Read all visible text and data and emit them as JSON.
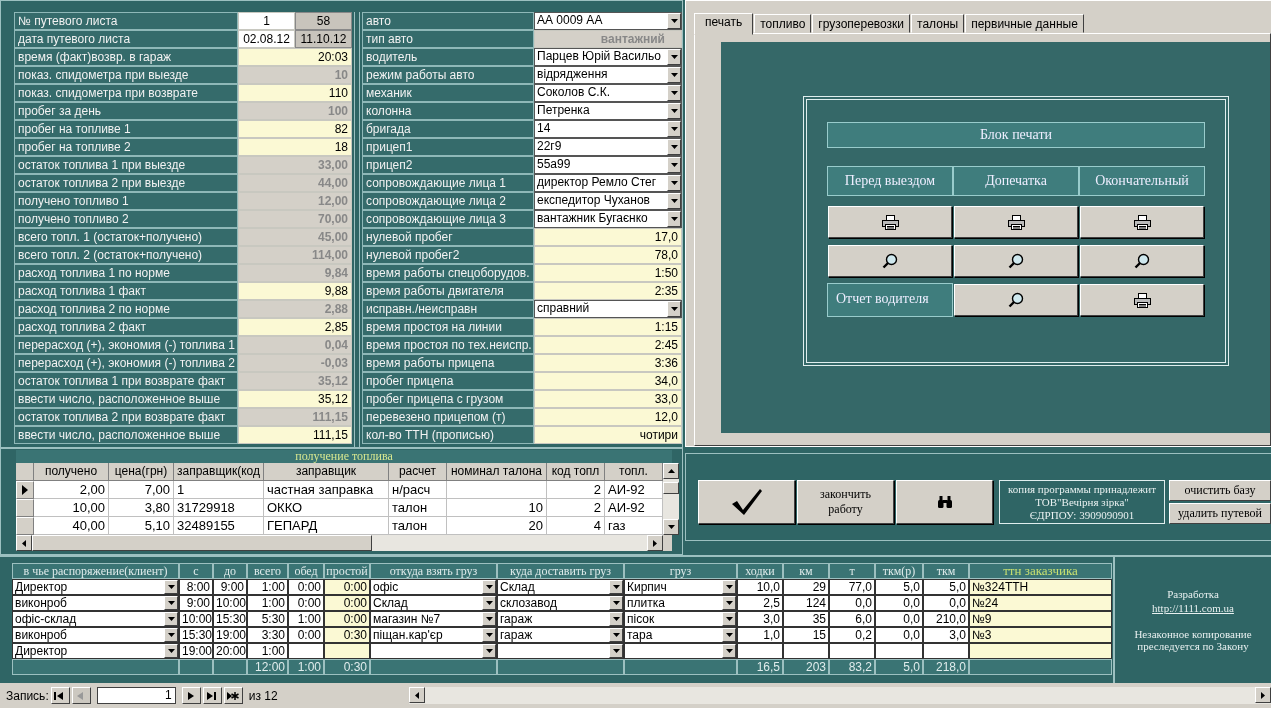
{
  "form": {
    "left": [
      {
        "label": "№ путевого листа",
        "values": [
          {
            "text": "1",
            "kind": "plain"
          },
          {
            "text": "58",
            "kind": "locked"
          }
        ]
      },
      {
        "label": "дата путевого листа",
        "values": [
          {
            "text": "02.08.12",
            "kind": "plain"
          },
          {
            "text": "11.10.12",
            "kind": "locked"
          }
        ]
      },
      {
        "label": "время (факт)возвр. в гараж",
        "values": [
          {
            "text": "20:03",
            "kind": "input"
          }
        ]
      },
      {
        "label": "показ. спидометра при выезде",
        "values": [
          {
            "text": "10",
            "kind": "calc"
          }
        ]
      },
      {
        "label": "показ. спидометра при возврате",
        "values": [
          {
            "text": "110",
            "kind": "input"
          }
        ]
      },
      {
        "label": "пробег за день",
        "values": [
          {
            "text": "100",
            "kind": "calc"
          }
        ]
      },
      {
        "label": "пробег на топливе 1",
        "values": [
          {
            "text": "82",
            "kind": "input"
          }
        ]
      },
      {
        "label": "пробег на топливе 2",
        "values": [
          {
            "text": "18",
            "kind": "input"
          }
        ]
      },
      {
        "label": "остаток  топлива 1 при выезде",
        "values": [
          {
            "text": "33,00",
            "kind": "calc"
          }
        ]
      },
      {
        "label": "остаток топлива 2 при выезде",
        "values": [
          {
            "text": "44,00",
            "kind": "calc"
          }
        ]
      },
      {
        "label": "получено топливо 1",
        "values": [
          {
            "text": "12,00",
            "kind": "calc"
          }
        ]
      },
      {
        "label": "получено топливо 2",
        "values": [
          {
            "text": "70,00",
            "kind": "calc"
          }
        ]
      },
      {
        "label": "всего топл. 1 (остаток+получено)",
        "values": [
          {
            "text": "45,00",
            "kind": "calc"
          }
        ]
      },
      {
        "label": "всего топл. 2 (остаток+получено)",
        "values": [
          {
            "text": "114,00",
            "kind": "calc"
          }
        ]
      },
      {
        "label": "расход топлива 1 по норме",
        "values": [
          {
            "text": "9,84",
            "kind": "calc"
          }
        ]
      },
      {
        "label": "расход топлива 1 факт",
        "values": [
          {
            "text": "9,88",
            "kind": "input"
          }
        ]
      },
      {
        "label": "расход топлива 2 по норме",
        "values": [
          {
            "text": "2,88",
            "kind": "calc"
          }
        ]
      },
      {
        "label": "расход топлива 2 факт",
        "values": [
          {
            "text": "2,85",
            "kind": "input"
          }
        ]
      },
      {
        "label": "перерасход (+), экономия (-) топлива 1",
        "values": [
          {
            "text": "0,04",
            "kind": "calc"
          }
        ]
      },
      {
        "label": "перерасход (+), экономия (-) топлива 2",
        "values": [
          {
            "text": "-0,03",
            "kind": "calc"
          }
        ]
      },
      {
        "label": "остаток топлива 1 при возврате факт",
        "values": [
          {
            "text": "35,12",
            "kind": "calc"
          }
        ]
      },
      {
        "label": "ввести число, расположенное выше",
        "values": [
          {
            "text": "35,12",
            "kind": "input"
          }
        ]
      },
      {
        "label": "остаток топлива 2 при возврате факт",
        "values": [
          {
            "text": "111,15",
            "kind": "calc"
          }
        ]
      },
      {
        "label": "ввести число, расположенное выше",
        "values": [
          {
            "text": "111,15",
            "kind": "input"
          }
        ]
      }
    ],
    "right": [
      {
        "label": "авто",
        "value": "АА 0009 АА",
        "kind": "combo"
      },
      {
        "label": "тип авто",
        "value": "вантажний",
        "kind": "readonly"
      },
      {
        "label": "водитель",
        "value": "Парцев Юрій Васильо",
        "kind": "combo"
      },
      {
        "label": "режим работы авто",
        "value": "відрядження",
        "kind": "combo"
      },
      {
        "label": "механик",
        "value": "Соколов С.К.",
        "kind": "combo"
      },
      {
        "label": "колонна",
        "value": "Петренка",
        "kind": "combo"
      },
      {
        "label": "бригада",
        "value": "14",
        "kind": "combo"
      },
      {
        "label": "прицеп1",
        "value": "22г9",
        "kind": "combo"
      },
      {
        "label": "прицеп2",
        "value": "55а99",
        "kind": "combo"
      },
      {
        "label": "сопровождающие  лица 1",
        "value": "директор Ремло Стег",
        "kind": "combo"
      },
      {
        "label": "сопровождающие лица 2",
        "value": "експедитор Чуханов",
        "kind": "combo"
      },
      {
        "label": "сопровождающие лица 3",
        "value": "вантажник Бугаєнко",
        "kind": "combo"
      },
      {
        "label": "нулевой пробег",
        "value": "17,0",
        "kind": "input"
      },
      {
        "label": "нулевой пробег2",
        "value": "78,0",
        "kind": "input"
      },
      {
        "label": "время работы спецоборудов.",
        "value": "1:50",
        "kind": "input"
      },
      {
        "label": "время работы двигателя",
        "value": "2:35",
        "kind": "input"
      },
      {
        "label": "исправн./неисправн",
        "value": "справний",
        "kind": "combo"
      },
      {
        "label": "время простоя на линии",
        "value": "1:15",
        "kind": "input"
      },
      {
        "label": "время простоя по тех.неиспр.",
        "value": "2:45",
        "kind": "input"
      },
      {
        "label": "время работы прицепа",
        "value": "3:36",
        "kind": "input"
      },
      {
        "label": "пробег прицепа",
        "value": "34,0",
        "kind": "input"
      },
      {
        "label": "пробег прицепа с грузом",
        "value": "33,0",
        "kind": "input"
      },
      {
        "label": "перевезено прицепом (т)",
        "value": "12,0",
        "kind": "input"
      },
      {
        "label": "кол-во ТТН (прописью)",
        "value": "чотири",
        "kind": "input"
      }
    ]
  },
  "fuel": {
    "title": "получение топлива",
    "columns": [
      {
        "label": "получено",
        "kind": "num"
      },
      {
        "label": "цена(грн)",
        "kind": "num"
      },
      {
        "label": "заправщик(код",
        "kind": "text"
      },
      {
        "label": "заправщик",
        "kind": "text"
      },
      {
        "label": "расчет",
        "kind": "text"
      },
      {
        "label": "номинал талона",
        "kind": "num"
      },
      {
        "label": "код топл",
        "kind": "num"
      },
      {
        "label": "топл.",
        "kind": "text"
      }
    ],
    "rows": [
      {
        "selected": true,
        "cells": [
          "2,00",
          "7,00",
          "1",
          "частная заправка",
          "н/расч",
          null,
          "2",
          "АИ-92"
        ]
      },
      {
        "selected": false,
        "cells": [
          "10,00",
          "3,80",
          "31729918",
          "ОККО",
          "талон",
          "10",
          "2",
          "АИ-92"
        ]
      },
      {
        "selected": false,
        "cells": [
          "40,00",
          "5,10",
          "32489155",
          "ГЕПАРД",
          "талон",
          "20",
          "4",
          "газ"
        ]
      }
    ]
  },
  "tabs": [
    {
      "label": "печать",
      "selected": true
    },
    {
      "label": "топливо",
      "selected": false
    },
    {
      "label": "грузоперевозки",
      "selected": false
    },
    {
      "label": "талоны",
      "selected": false
    },
    {
      "label": "первичные данные",
      "selected": false
    }
  ],
  "print_block": {
    "title": "Блок печати",
    "columns": [
      "Перед выездом",
      "Допечатка",
      "Окончательный"
    ],
    "rows": [
      {
        "buttons": [
          {
            "kind": "print"
          },
          {
            "kind": "print"
          },
          {
            "kind": "print"
          }
        ]
      },
      {
        "buttons": [
          {
            "kind": "preview"
          },
          {
            "kind": "preview"
          },
          {
            "kind": "preview"
          }
        ]
      },
      {
        "label": "Отчет водителя",
        "buttons": [
          {
            "kind": "preview"
          },
          {
            "kind": "print"
          }
        ]
      }
    ]
  },
  "actions": [
    {
      "kind": "check"
    },
    {
      "kind": "text",
      "label": "закончить работу"
    },
    {
      "kind": "find"
    }
  ],
  "owner": {
    "lines": [
      "копия программы принадлежит",
      "ТОВ\"Вечірня зірка\"",
      "ЄДРПОУ: 3909090901"
    ]
  },
  "side_buttons": [
    "очистить базу",
    "удалить путевой"
  ],
  "trips": {
    "columns": [
      {
        "label": "в чье распоряжение(клиент)",
        "kind": "combo"
      },
      {
        "label": "с",
        "kind": "num"
      },
      {
        "label": "до",
        "kind": "num"
      },
      {
        "label": "всего",
        "kind": "num"
      },
      {
        "label": "обед",
        "kind": "num"
      },
      {
        "label": "простой",
        "kind": "input"
      },
      {
        "label": "откуда взять груз",
        "kind": "combo"
      },
      {
        "label": "куда доставить груз",
        "kind": "combo"
      },
      {
        "label": "груз",
        "kind": "combo"
      },
      {
        "label": "ходки",
        "kind": "num"
      },
      {
        "label": "км",
        "kind": "num"
      },
      {
        "label": "т",
        "kind": "num"
      },
      {
        "label": "ткм(р)",
        "kind": "num"
      },
      {
        "label": "ткм",
        "kind": "num"
      },
      {
        "label": "ттн заказчика",
        "kind": "note"
      }
    ],
    "rows": [
      {
        "cells": [
          "Директор",
          "8:00",
          "9:00",
          "1:00",
          "0:00",
          "0:00",
          "офіс",
          "Склад",
          "Кирпич",
          "10,0",
          "29",
          "77,0",
          "5,0",
          "5,0",
          "№324ТТН"
        ]
      },
      {
        "cells": [
          "виконроб",
          "9:00",
          "10:00",
          "1:00",
          "0:00",
          "0:00",
          "Склад",
          "склозавод",
          "плитка",
          "2,5",
          "124",
          "0,0",
          "0,0",
          "0,0",
          "№24"
        ]
      },
      {
        "cells": [
          "офіс-склад",
          "10:00",
          "15:30",
          "5:30",
          "1:00",
          "0:00",
          "магазин №7",
          "гараж",
          "пісок",
          "3,0",
          "35",
          "6,0",
          "0,0",
          "210,0",
          "№9"
        ]
      },
      {
        "cells": [
          "виконроб",
          "15:30",
          "19:00",
          "3:30",
          "0:00",
          "0:30",
          "піщан.кар'єр",
          "гараж",
          "тара",
          "1,0",
          "15",
          "0,2",
          "0,0",
          "3,0",
          "№3"
        ]
      },
      {
        "cells": [
          "Директор",
          "19:00",
          "20:00",
          "1:00",
          null,
          null,
          null,
          null,
          null,
          null,
          null,
          null,
          null,
          null,
          null
        ]
      }
    ],
    "totals": [
      {
        "kind": "empty"
      },
      {
        "kind": "empty"
      },
      {
        "kind": "empty"
      },
      {
        "kind": "total",
        "value": "12:00"
      },
      {
        "kind": "total",
        "value": "1:00"
      },
      {
        "kind": "total",
        "value": "0:30"
      },
      {
        "kind": "empty"
      },
      {
        "kind": "empty"
      },
      {
        "kind": "empty"
      },
      {
        "kind": "total",
        "value": "16,5"
      },
      {
        "kind": "total",
        "value": "203"
      },
      {
        "kind": "total",
        "value": "83,2"
      },
      {
        "kind": "total",
        "value": "5,0"
      },
      {
        "kind": "total",
        "value": "218,0"
      },
      {
        "kind": "empty"
      }
    ]
  },
  "developer": {
    "title": "Разработка",
    "link": "http://1111.com.ua",
    "notice": "Незаконное копирование преследуется по Закону"
  },
  "nav": {
    "label": "Запись:",
    "buttons": [
      {
        "kind": "first",
        "disabled": false
      },
      {
        "kind": "prev",
        "disabled": true
      },
      {
        "kind": "next",
        "disabled": false
      },
      {
        "kind": "last",
        "disabled": false
      },
      {
        "kind": "new",
        "disabled": false
      }
    ],
    "value": "1",
    "of": "из 12"
  }
}
